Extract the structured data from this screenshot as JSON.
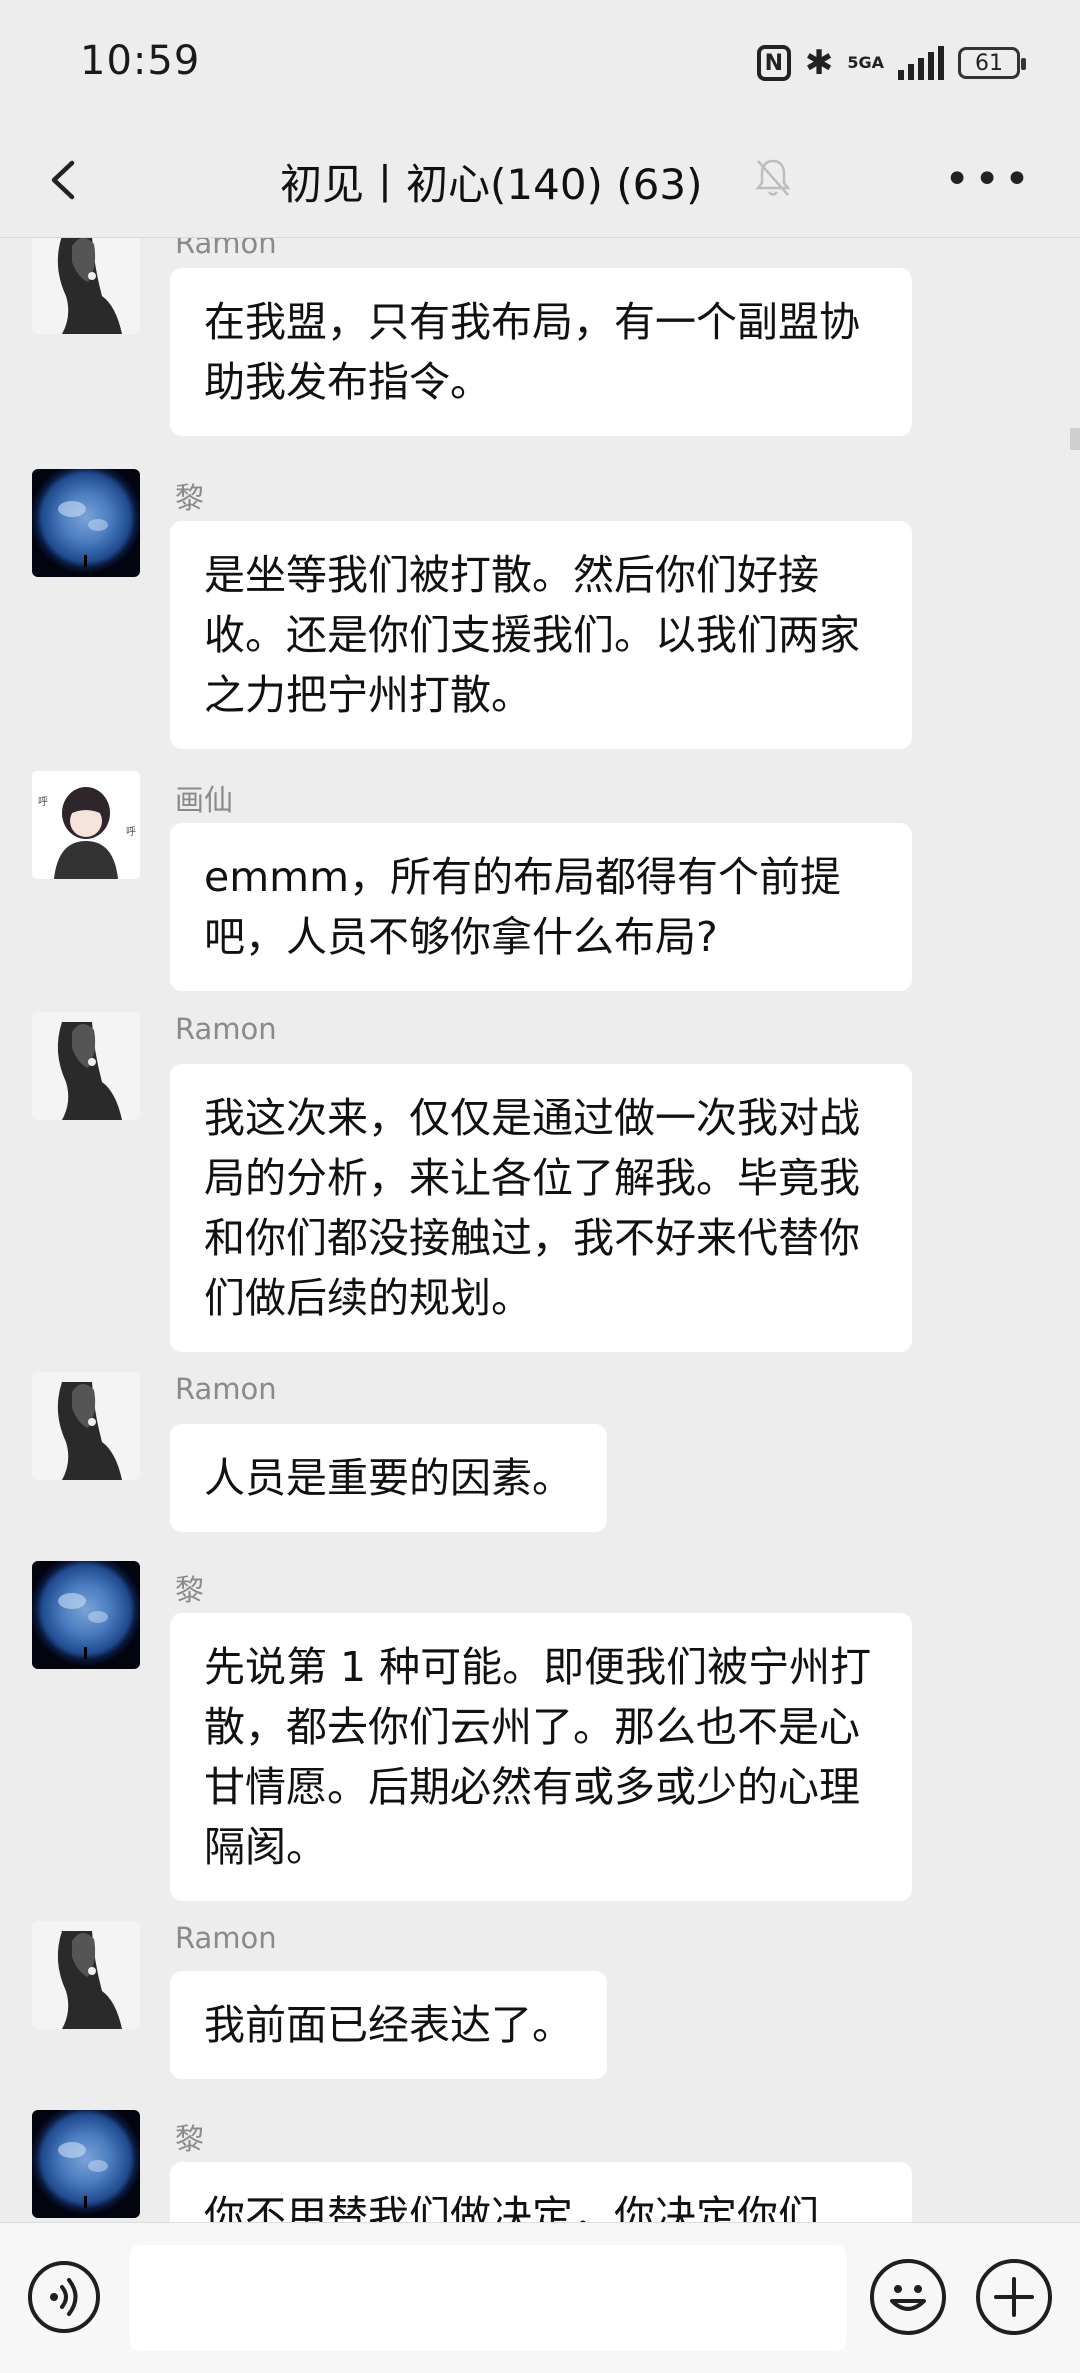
{
  "status_bar": {
    "time": "10:59",
    "nfc_label": "N",
    "network": "5GA",
    "battery": "61",
    "icons": [
      "nfc-icon",
      "bluetooth-icon",
      "signal-icon",
      "battery-icon"
    ]
  },
  "header": {
    "title": "初见丨初心(140) (63)",
    "icons": [
      "back-arrow-icon",
      "muted-bell-icon",
      "more-icon"
    ]
  },
  "messages": [
    {
      "sender": "Ramon",
      "avatar": "girl-silhouette",
      "text": "在我盟，只有我布局，有一个副盟协助我发布指令。"
    },
    {
      "sender": "黎",
      "avatar": "earth",
      "text": "是坐等我们被打散。然后你们好接收。还是你们支援我们。以我们两家之力把宁州打散。"
    },
    {
      "sender": "画仙",
      "avatar": "anime-girl",
      "text": "emmm，所有的布局都得有个前提吧，人员不够你拿什么布局?"
    },
    {
      "sender": "Ramon",
      "avatar": "girl-silhouette",
      "text": "我这次来，仅仅是通过做一次我对战局的分析，来让各位了解我。毕竟我和你们都没接触过，我不好来代替你们做后续的规划。"
    },
    {
      "sender": "Ramon",
      "avatar": "girl-silhouette",
      "text": "人员是重要的因素。"
    },
    {
      "sender": "黎",
      "avatar": "earth",
      "text": "先说第 1 种可能。即便我们被宁州打散，都去你们云州了。那么也不是心甘情愿。后期必然有或多或少的心理隔阂。"
    },
    {
      "sender": "Ramon",
      "avatar": "girl-silhouette",
      "text": "我前面已经表达了。"
    },
    {
      "sender": "黎",
      "avatar": "earth",
      "text": "你不用替我们做决定，你决定你们"
    }
  ],
  "input_bar": {
    "text_value": "",
    "icons": [
      "voice-icon",
      "emoji-icon",
      "plus-icon"
    ]
  }
}
